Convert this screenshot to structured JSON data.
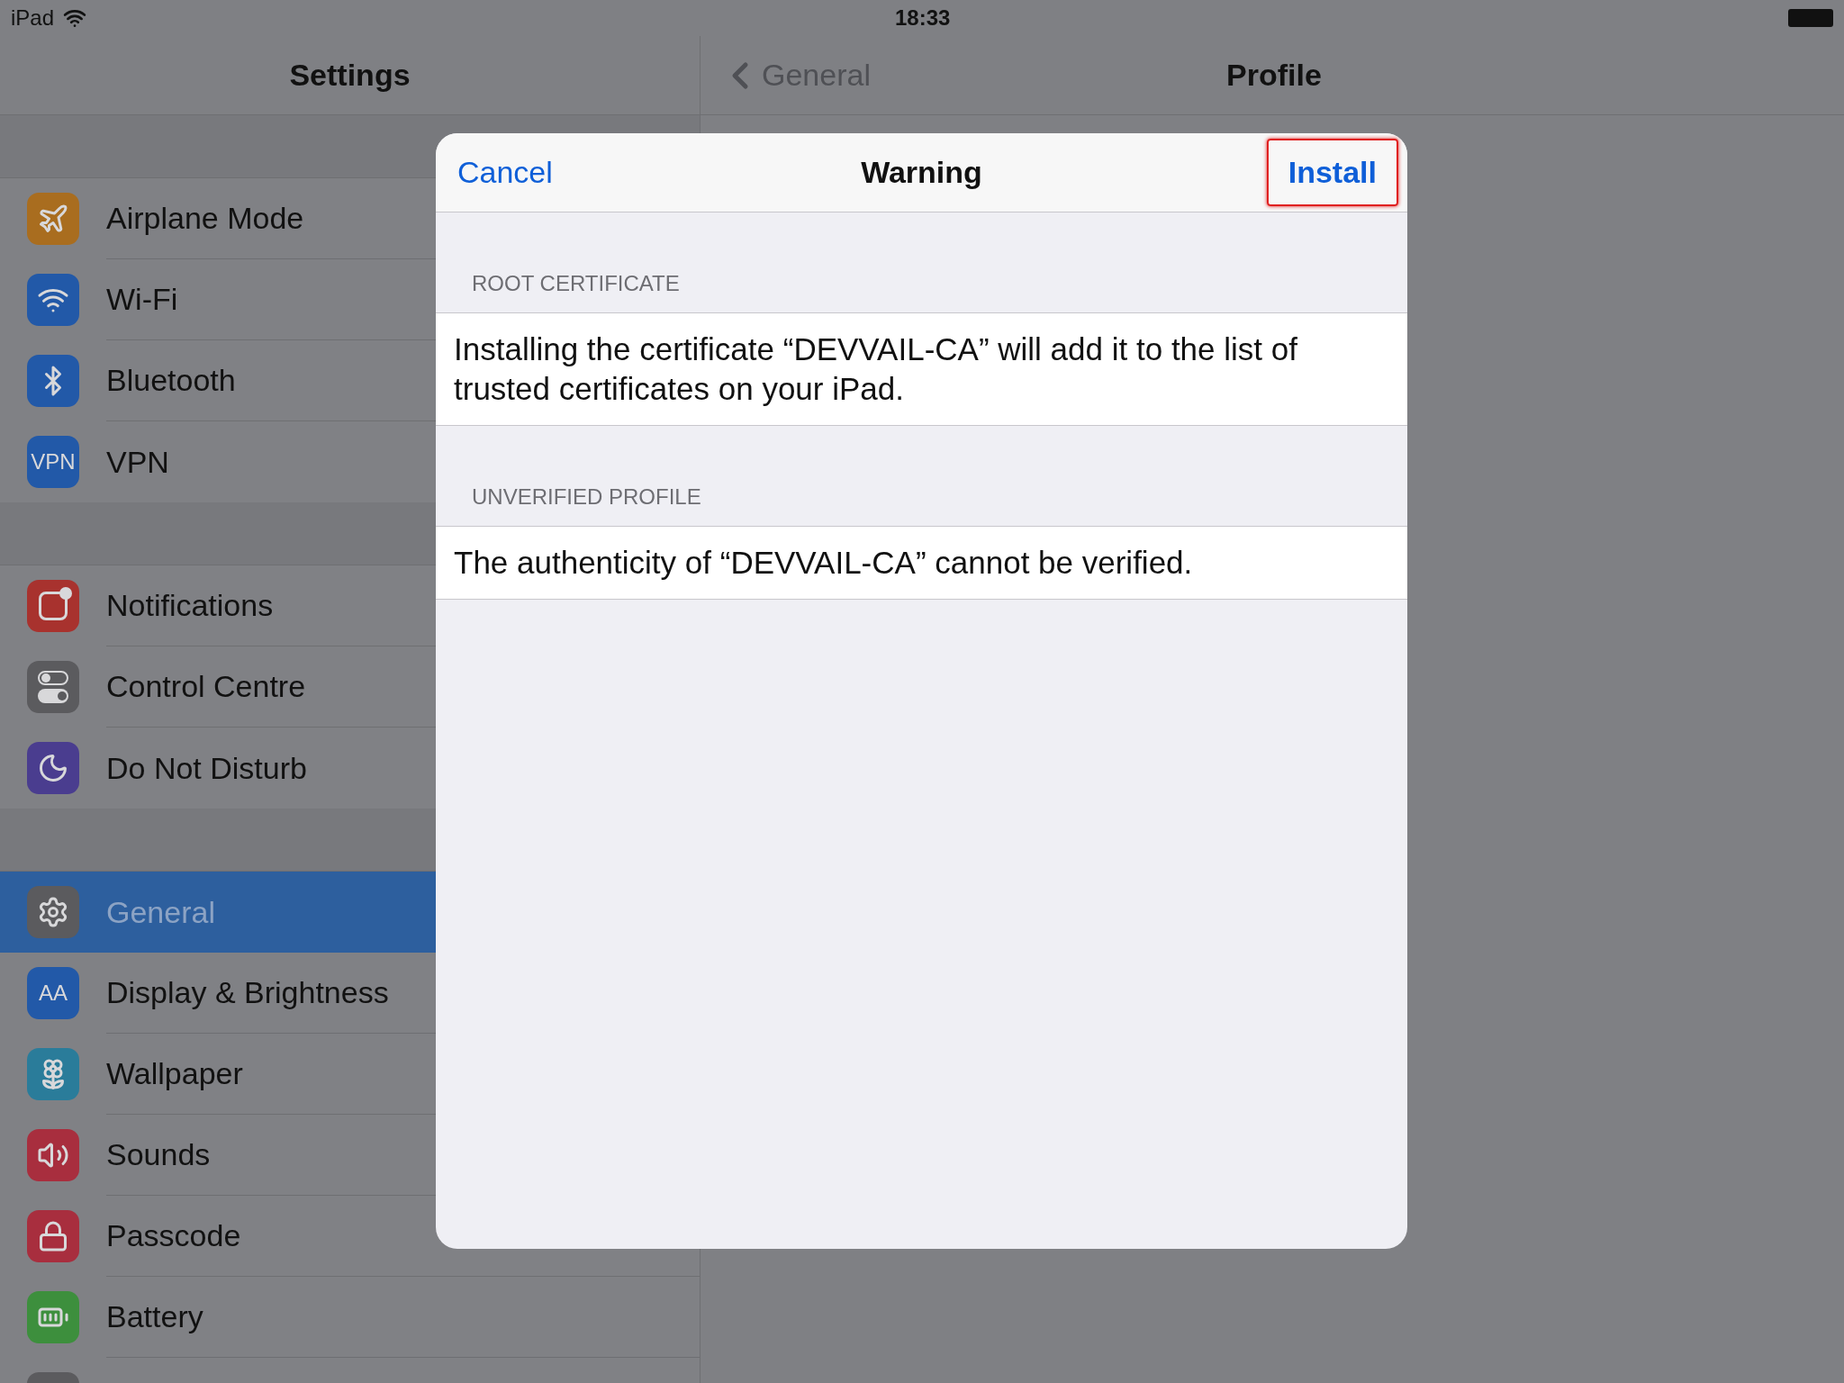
{
  "status_bar": {
    "device": "iPad",
    "time": "18:33"
  },
  "sidebar": {
    "title": "Settings",
    "groups": [
      {
        "items": [
          {
            "label": "Airplane Mode",
            "kind": "plane",
            "color": "#a96d1f",
            "selected": false
          },
          {
            "label": "Wi-Fi",
            "kind": "wifi",
            "color": "#2259a8",
            "selected": false
          },
          {
            "label": "Bluetooth",
            "kind": "bluetooth",
            "color": "#2259a8",
            "selected": false
          },
          {
            "label": "VPN",
            "kind": "text",
            "icon_text": "VPN",
            "color": "#2259a8",
            "selected": false
          }
        ]
      },
      {
        "items": [
          {
            "label": "Notifications",
            "kind": "notifications",
            "color": "#a8322e",
            "selected": false
          },
          {
            "label": "Control Centre",
            "kind": "toggles",
            "color": "#5b5b5e",
            "selected": false
          },
          {
            "label": "Do Not Disturb",
            "kind": "moon",
            "color": "#4a3d8f",
            "selected": false
          }
        ]
      },
      {
        "items": [
          {
            "label": "General",
            "kind": "gear",
            "color": "#5b5b5e",
            "selected": true
          },
          {
            "label": "Display & Brightness",
            "kind": "text",
            "icon_text": "AA",
            "color": "#2259a8",
            "selected": false
          },
          {
            "label": "Wallpaper",
            "kind": "flower",
            "color": "#2a7c9a",
            "selected": false
          },
          {
            "label": "Sounds",
            "kind": "speaker",
            "color": "#a82e3e",
            "selected": false
          },
          {
            "label": "Passcode",
            "kind": "lock",
            "color": "#a82e3e",
            "selected": false
          },
          {
            "label": "Battery",
            "kind": "battery",
            "color": "#3d8f3d",
            "selected": false
          },
          {
            "kind": "blank",
            "color": "#5b5b5e",
            "selected": false
          }
        ]
      }
    ]
  },
  "detail": {
    "back": "General",
    "title": "Profile"
  },
  "dialog": {
    "cancel": "Cancel",
    "title": "Warning",
    "confirm": {
      "label": "Install",
      "highlighted": true
    },
    "sections": [
      {
        "header": "ROOT CERTIFICATE",
        "text": "Installing the certificate “DEVVAIL-CA” will add it to the list of trusted certificates on your iPad."
      },
      {
        "header": "UNVERIFIED PROFILE",
        "text": "The authenticity of “DEVVAIL-CA” cannot be verified."
      }
    ]
  }
}
